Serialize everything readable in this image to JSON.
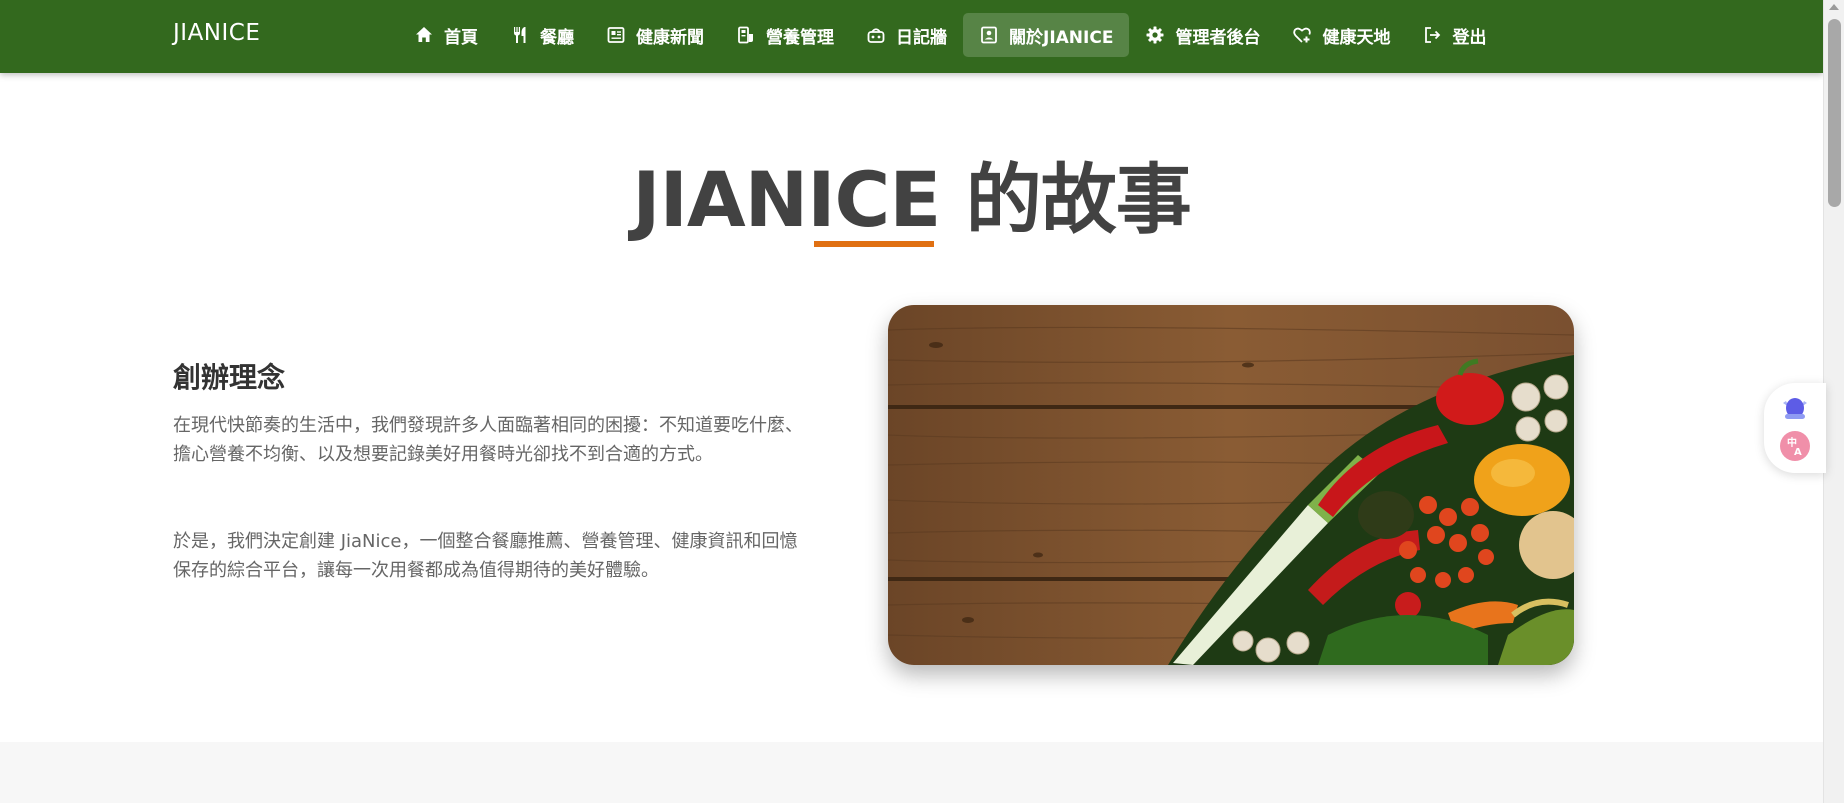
{
  "nav": {
    "brand": "JIANICE",
    "items": [
      {
        "label": "首頁",
        "icon": "home-icon"
      },
      {
        "label": "餐廳",
        "icon": "utensils-icon"
      },
      {
        "label": "健康新聞",
        "icon": "newspaper-icon"
      },
      {
        "label": "營養管理",
        "icon": "nutrition-icon"
      },
      {
        "label": "日記牆",
        "icon": "diary-icon"
      },
      {
        "label": "關於JIANICE",
        "icon": "contact-card-icon",
        "active": true
      },
      {
        "label": "管理者後台",
        "icon": "gear-icon"
      },
      {
        "label": "健康天地",
        "icon": "heart-plus-icon"
      },
      {
        "label": "登出",
        "icon": "logout-icon"
      }
    ],
    "background_color": "#33691e"
  },
  "main": {
    "title": "JIANICE 的故事",
    "accent_color": "#e07012",
    "philosophy": {
      "heading": "創辦理念",
      "paragraphs": [
        "在現代快節奏的生活中，我們發現許多人面臨著相同的困擾：不知道要吃什麼、擔心營養不均衡、以及想要記錄美好用餐時光卻找不到合適的方式。",
        "於是，我們決定創建 JiaNice，一個整合餐廳推薦、營養管理、健康資訊和回憶保存的綜合平台，讓每一次用餐都成為值得期待的美好體驗。"
      ]
    },
    "image": "vegetables-on-wooden-table"
  },
  "widget": {
    "icons": [
      "assistant-icon",
      "translate-icon"
    ]
  }
}
